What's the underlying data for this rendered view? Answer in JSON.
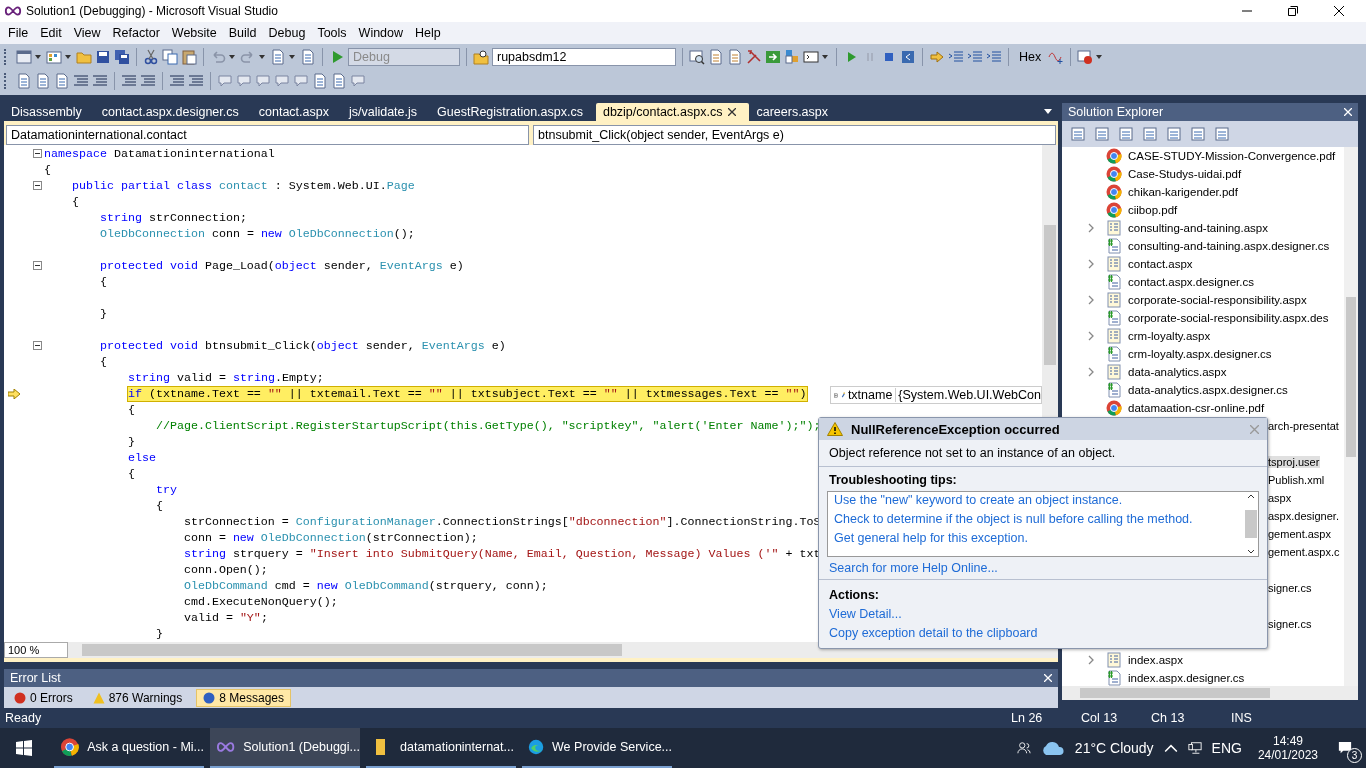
{
  "window": {
    "title": "Solution1 (Debugging) - Microsoft Visual Studio"
  },
  "menu": [
    "File",
    "Edit",
    "View",
    "Refactor",
    "Website",
    "Build",
    "Debug",
    "Tools",
    "Window",
    "Help"
  ],
  "toolbar": {
    "configuration": {
      "value": "Debug",
      "disabled": true
    },
    "target": {
      "value": "rupabsdm12"
    },
    "hex_button": "Hex"
  },
  "document_tabs": [
    {
      "label": "Disassembly",
      "selected": false
    },
    {
      "label": "contact.aspx.designer.cs",
      "selected": false
    },
    {
      "label": "contact.aspx",
      "selected": false
    },
    {
      "label": "js/validate.js",
      "selected": false
    },
    {
      "label": "GuestRegistration.aspx.cs",
      "selected": false
    },
    {
      "label": "dbzip/contact.aspx.cs",
      "selected": true
    },
    {
      "label": "careers.aspx",
      "selected": false
    }
  ],
  "navigation": {
    "type_dropdown": "Datamationinternational.contact",
    "member_dropdown": "btnsubmit_Click(object sender, EventArgs e)"
  },
  "code_lines": [
    {
      "fold": true,
      "segs": [
        {
          "kind": "keyword",
          "text": "namespace"
        },
        {
          "kind": "plain",
          "text": " Datamationinternational"
        }
      ]
    },
    {
      "segs": [
        {
          "kind": "plain",
          "text": "{"
        }
      ]
    },
    {
      "fold": true,
      "segs": [
        {
          "kind": "keyword",
          "text": "    public partial class "
        },
        {
          "kind": "type",
          "text": "contact"
        },
        {
          "kind": "plain",
          "text": " : System.Web.UI."
        },
        {
          "kind": "type",
          "text": "Page"
        }
      ]
    },
    {
      "segs": [
        {
          "kind": "plain",
          "text": "    {"
        }
      ]
    },
    {
      "segs": [
        {
          "kind": "keyword",
          "text": "        string"
        },
        {
          "kind": "plain",
          "text": " strConnection;"
        }
      ]
    },
    {
      "segs": [
        {
          "kind": "type",
          "text": "        OleDbConnection"
        },
        {
          "kind": "plain",
          "text": " conn = "
        },
        {
          "kind": "keyword",
          "text": "new "
        },
        {
          "kind": "type",
          "text": "OleDbConnection"
        },
        {
          "kind": "plain",
          "text": "();"
        }
      ]
    },
    {
      "kind": "blank"
    },
    {
      "fold": true,
      "segs": [
        {
          "kind": "keyword",
          "text": "        protected void"
        },
        {
          "kind": "plain",
          "text": " Page_Load("
        },
        {
          "kind": "keyword",
          "text": "object"
        },
        {
          "kind": "plain",
          "text": " sender, "
        },
        {
          "kind": "type",
          "text": "EventArgs"
        },
        {
          "kind": "plain",
          "text": " e)"
        }
      ]
    },
    {
      "segs": [
        {
          "kind": "plain",
          "text": "        {"
        }
      ]
    },
    {
      "kind": "blank"
    },
    {
      "segs": [
        {
          "kind": "plain",
          "text": "        }"
        }
      ]
    },
    {
      "kind": "blank"
    },
    {
      "fold": true,
      "segs": [
        {
          "kind": "keyword",
          "text": "        protected void"
        },
        {
          "kind": "plain",
          "text": " btnsubmit_Click("
        },
        {
          "kind": "keyword",
          "text": "object"
        },
        {
          "kind": "plain",
          "text": " sender, "
        },
        {
          "kind": "type",
          "text": "EventArgs"
        },
        {
          "kind": "plain",
          "text": " e)"
        }
      ]
    },
    {
      "segs": [
        {
          "kind": "plain",
          "text": "        {"
        }
      ]
    },
    {
      "segs": [
        {
          "kind": "keyword",
          "text": "            string"
        },
        {
          "kind": "plain",
          "text": " valid = "
        },
        {
          "kind": "keyword",
          "text": "string"
        },
        {
          "kind": "plain",
          "text": ".Empty;"
        }
      ]
    },
    {
      "current": true,
      "segs": [
        {
          "kind": "keyword",
          "text": "            if"
        },
        {
          "kind": "plain",
          "text": " (txtname.Text == "
        },
        {
          "kind": "string",
          "text": "\"\""
        },
        {
          "kind": "plain",
          "text": " || txtemail.Text == "
        },
        {
          "kind": "string",
          "text": "\"\""
        },
        {
          "kind": "plain",
          "text": " || txtsubject.Text == "
        },
        {
          "kind": "string",
          "text": "\"\""
        },
        {
          "kind": "plain",
          "text": " || txtmessages.Text == "
        },
        {
          "kind": "string",
          "text": "\"\""
        },
        {
          "kind": "plain",
          "text": ")"
        }
      ]
    },
    {
      "segs": [
        {
          "kind": "plain",
          "text": "            {"
        }
      ]
    },
    {
      "segs": [
        {
          "kind": "comment",
          "text": "                //Page.ClientScript.RegisterStartupScript(this.GetType(), \"scriptkey\", \"alert('Enter Name');\");"
        }
      ]
    },
    {
      "segs": [
        {
          "kind": "plain",
          "text": "            }"
        }
      ]
    },
    {
      "segs": [
        {
          "kind": "keyword",
          "text": "            else"
        }
      ]
    },
    {
      "segs": [
        {
          "kind": "plain",
          "text": "            {"
        }
      ]
    },
    {
      "segs": [
        {
          "kind": "keyword",
          "text": "                try"
        }
      ]
    },
    {
      "segs": [
        {
          "kind": "plain",
          "text": "                {"
        }
      ]
    },
    {
      "segs": [
        {
          "kind": "plain",
          "text": "                    strConnection = "
        },
        {
          "kind": "type",
          "text": "ConfigurationManager"
        },
        {
          "kind": "plain",
          "text": ".ConnectionStrings["
        },
        {
          "kind": "string",
          "text": "\"dbconnection\""
        },
        {
          "kind": "plain",
          "text": "].ConnectionString.ToS"
        }
      ]
    },
    {
      "segs": [
        {
          "kind": "plain",
          "text": "                    conn = "
        },
        {
          "kind": "keyword",
          "text": "new "
        },
        {
          "kind": "type",
          "text": "OleDbConnection"
        },
        {
          "kind": "plain",
          "text": "(strConnection);"
        }
      ]
    },
    {
      "segs": [
        {
          "kind": "keyword",
          "text": "                    string"
        },
        {
          "kind": "plain",
          "text": " strquery = "
        },
        {
          "kind": "string",
          "text": "\"Insert into SubmitQuery(Name, Email, Question, Message) Values ('\""
        },
        {
          "kind": "plain",
          "text": " + txt"
        }
      ]
    },
    {
      "segs": [
        {
          "kind": "plain",
          "text": "                    conn.Open();"
        }
      ]
    },
    {
      "segs": [
        {
          "kind": "type",
          "text": "                    OleDbCommand"
        },
        {
          "kind": "plain",
          "text": " cmd = "
        },
        {
          "kind": "keyword",
          "text": "new "
        },
        {
          "kind": "type",
          "text": "OleDbCommand"
        },
        {
          "kind": "plain",
          "text": "(strquery, conn);"
        }
      ]
    },
    {
      "segs": [
        {
          "kind": "plain",
          "text": "                    cmd.ExecuteNonQuery();"
        }
      ]
    },
    {
      "segs": [
        {
          "kind": "plain",
          "text": "                    valid = "
        },
        {
          "kind": "string",
          "text": "\"Y\""
        },
        {
          "kind": "plain",
          "text": ";"
        }
      ]
    },
    {
      "segs": [
        {
          "kind": "plain",
          "text": "                }"
        }
      ]
    }
  ],
  "zoom": "100 %",
  "datatip": {
    "name": "txtname",
    "value": "{System.Web.UI.WebCon"
  },
  "exception_popup": {
    "title": "NullReferenceException occurred",
    "message": "Object reference not set to an instance of an object.",
    "tips_heading": "Troubleshooting tips:",
    "tips": [
      "Use the \"new\" keyword to create an object instance.",
      "Check to determine if the object is null before calling the method.",
      "Get general help for this exception."
    ],
    "search_link": "Search for more Help Online...",
    "actions_heading": "Actions:",
    "actions": [
      "View Detail...",
      "Copy exception detail to the clipboard"
    ]
  },
  "solution_explorer": {
    "title": "Solution Explorer",
    "items": [
      {
        "kind": "pdf",
        "label": "CASE-STUDY-Mission-Convergence.pdf",
        "expandable": false,
        "selected": false
      },
      {
        "kind": "pdf",
        "label": "Case-Studys-uidai.pdf",
        "expandable": false,
        "selected": false
      },
      {
        "kind": "pdf",
        "label": "chikan-karigender.pdf",
        "expandable": false,
        "selected": false
      },
      {
        "kind": "pdf",
        "label": "ciibop.pdf",
        "expandable": false,
        "selected": false
      },
      {
        "kind": "page",
        "label": "consulting-and-taining.aspx",
        "expandable": true,
        "selected": false
      },
      {
        "kind": "code",
        "label": "consulting-and-taining.aspx.designer.cs",
        "expandable": false,
        "selected": false
      },
      {
        "kind": "page",
        "label": "contact.aspx",
        "expandable": true,
        "selected": false
      },
      {
        "kind": "code",
        "label": "contact.aspx.designer.cs",
        "expandable": false,
        "selected": false
      },
      {
        "kind": "page",
        "label": "corporate-social-responsibility.aspx",
        "expandable": true,
        "selected": false
      },
      {
        "kind": "code",
        "label": "corporate-social-responsibility.aspx.des",
        "expandable": false,
        "selected": false
      },
      {
        "kind": "page",
        "label": "crm-loyalty.aspx",
        "expandable": true,
        "selected": false
      },
      {
        "kind": "code",
        "label": "crm-loyalty.aspx.designer.cs",
        "expandable": false,
        "selected": false
      },
      {
        "kind": "page",
        "label": "data-analytics.aspx",
        "expandable": true,
        "selected": false
      },
      {
        "kind": "code",
        "label": "data-analytics.aspx.designer.cs",
        "expandable": false,
        "selected": false
      },
      {
        "kind": "pdf",
        "label": "datamaation-csr-online.pdf",
        "expandable": false,
        "selected": false
      },
      {
        "kind": "partial",
        "label": "arch-presentat",
        "selected": false
      },
      {
        "kind": "covered"
      },
      {
        "kind": "partial",
        "label": "tsproj.user",
        "selected": true
      },
      {
        "kind": "partial",
        "label": "Publish.xml",
        "selected": false
      },
      {
        "kind": "partial",
        "label": "aspx",
        "selected": false
      },
      {
        "kind": "partial",
        "label": "aspx.designer.",
        "selected": false
      },
      {
        "kind": "partial",
        "label": "gement.aspx",
        "selected": false
      },
      {
        "kind": "partial",
        "label": "gement.aspx.c",
        "selected": false
      },
      {
        "kind": "covered"
      },
      {
        "kind": "partial",
        "label": "signer.cs",
        "selected": false
      },
      {
        "kind": "covered"
      },
      {
        "kind": "partial",
        "label": "signer.cs",
        "selected": false
      },
      {
        "kind": "covered"
      },
      {
        "kind": "page",
        "label": "index.aspx",
        "expandable": true,
        "selected": false
      },
      {
        "kind": "code",
        "label": "index.aspx.designer.cs",
        "expandable": false,
        "selected": false
      }
    ]
  },
  "error_list": {
    "title": "Error List",
    "filters": [
      {
        "kind": "error",
        "label": "0 Errors",
        "selected": false
      },
      {
        "kind": "warning",
        "label": "876 Warnings",
        "selected": false
      },
      {
        "kind": "info",
        "label": "8 Messages",
        "selected": true
      }
    ]
  },
  "status_bar": {
    "state": "Ready",
    "line": "Ln 26",
    "column": "Col 13",
    "char": "Ch 13",
    "mode": "INS"
  },
  "taskbar": {
    "apps": [
      {
        "kind": "browser",
        "label": "Ask a question - Mi...",
        "selected": false
      },
      {
        "kind": "studio",
        "label": "Solution1 (Debuggi...",
        "selected": true
      },
      {
        "kind": "folder",
        "label": "datamationinternat...",
        "selected": false
      },
      {
        "kind": "edge",
        "label": "We Provide Service...",
        "selected": false
      }
    ],
    "weather": "21°C  Cloudy",
    "language": "ENG",
    "time": "14:49",
    "date": "24/01/2023",
    "notifications": "3"
  }
}
